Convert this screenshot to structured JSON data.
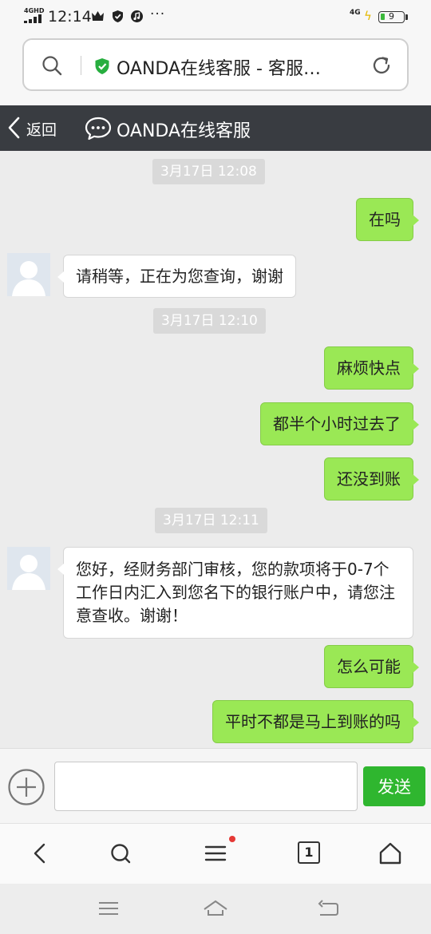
{
  "status_bar": {
    "network_left": "4GHD",
    "time": "12:14",
    "more": "···",
    "network_right": "4G",
    "battery": "9"
  },
  "address_bar": {
    "title": "OANDA在线客服 - 客服…"
  },
  "chat_header": {
    "back_label": "返回",
    "title": "OANDA在线客服"
  },
  "messages": {
    "ts1": "3月17日 12:08",
    "m1": "在吗",
    "m2": "请稍等，正在为您查询，谢谢",
    "ts2": "3月17日 12:10",
    "m3": "麻烦快点",
    "m4": "都半个小时过去了",
    "m5": "还没到账",
    "ts3": "3月17日 12:11",
    "m6": "您好，经财务部门审核，您的款项将于0-7个工作日内汇入到您名下的银行账户中，请您注意查收。谢谢！",
    "m7": "怎么可能",
    "m8": "平时不都是马上到账的吗"
  },
  "input_bar": {
    "value": "",
    "send_label": "发送"
  },
  "toolbar": {
    "tabs_count": "1"
  },
  "colors": {
    "outgoing_bubble": "#9ae855",
    "incoming_bubble": "#ffffff",
    "header_bg": "#393c41",
    "send_button": "#2fb62f",
    "notification_dot": "#e53935"
  }
}
